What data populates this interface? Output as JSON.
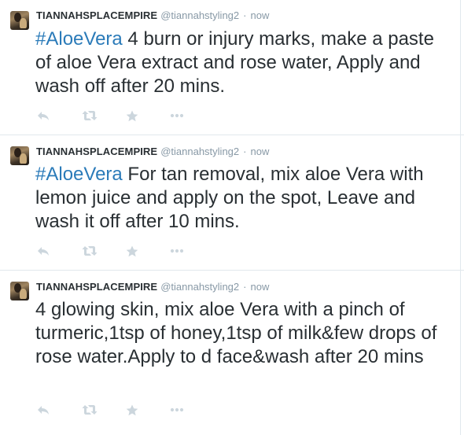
{
  "tweets": [
    {
      "fullname": "TIANNAHSPLACEMPIRE",
      "username": "@tiannahstyling2",
      "separator": "·",
      "time": "now",
      "hashtag": "#AloeVera",
      "text": " 4 burn or injury marks, make a paste of aloe Vera extract and rose water, Apply and wash off after 20 mins."
    },
    {
      "fullname": "TIANNAHSPLACEMPIRE",
      "username": "@tiannahstyling2",
      "separator": "·",
      "time": "now",
      "hashtag": "#AloeVera",
      "text": " For tan removal, mix aloe Vera with lemon juice and apply on the spot, Leave and wash it off after 10 mins."
    },
    {
      "fullname": "TIANNAHSPLACEMPIRE",
      "username": "@tiannahstyling2",
      "separator": "·",
      "time": "now",
      "hashtag": "",
      "text": "4 glowing skin, mix aloe Vera with a pinch of turmeric,1tsp of honey,1tsp of milk&few drops of rose water.Apply to d face&wash after 20 mins"
    }
  ],
  "actions": {
    "reply_icon": "reply-icon",
    "retweet_icon": "retweet-icon",
    "favorite_icon": "star-icon",
    "more_icon": "more-icon"
  },
  "colors": {
    "hashtag": "#2b7bb9",
    "meta": "#8899a6",
    "icon": "#ccd6dd",
    "text": "#292f33",
    "divider": "#e1e8ed"
  }
}
